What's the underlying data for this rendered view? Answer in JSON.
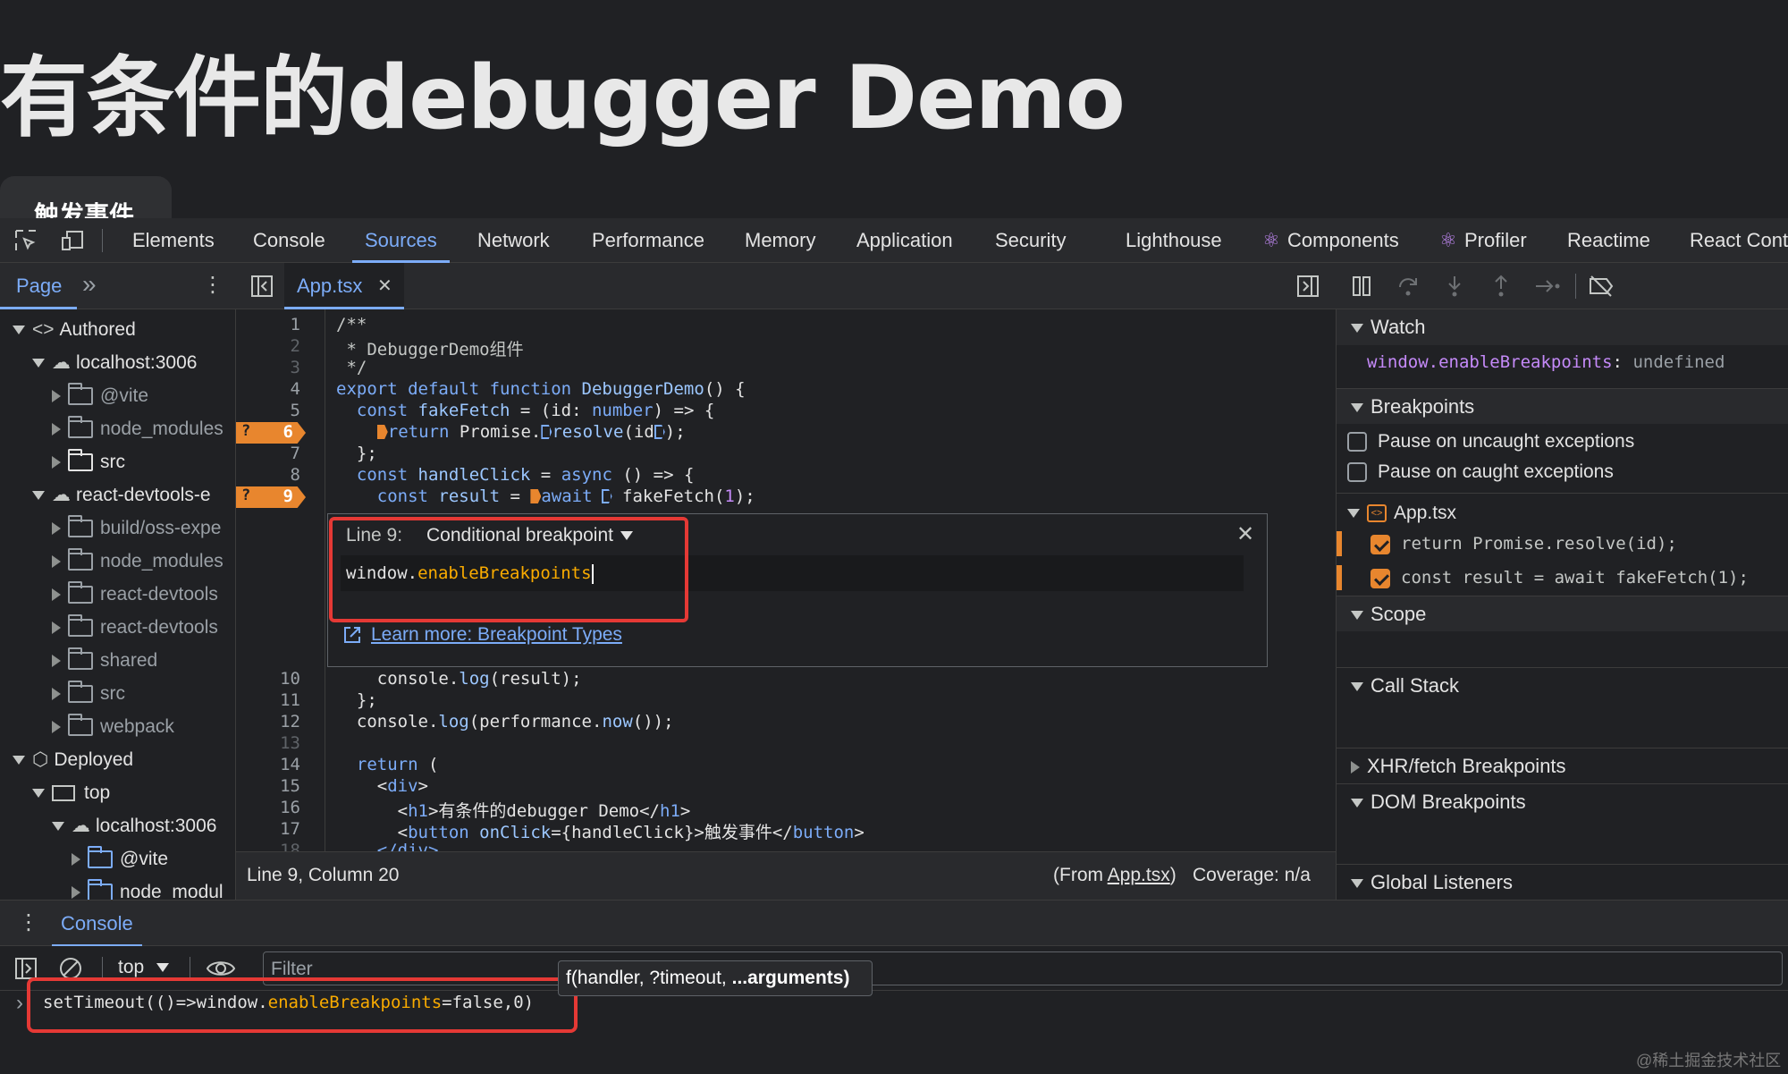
{
  "page": {
    "heading": "有条件的debugger Demo",
    "button_label": "触发事件"
  },
  "devtools_tabs": [
    "Elements",
    "Console",
    "Sources",
    "Network",
    "Performance",
    "Memory",
    "Application",
    "Security",
    "Lighthouse",
    "Components",
    "Profiler",
    "Reactime",
    "React Cont"
  ],
  "active_tab": "Sources",
  "navigator": {
    "tab_label": "Page",
    "more": "»",
    "rows": [
      "Authored",
      "localhost:3006",
      "@vite",
      "node_modules",
      "src",
      "react-devtools-e",
      "build/oss-expe",
      "node_modules",
      "react-devtools",
      "react-devtools",
      "shared",
      "src",
      "webpack",
      "Deployed",
      "top",
      "localhost:3006",
      "@vite",
      "node_modul"
    ]
  },
  "editor": {
    "file_tab": "App.tsx",
    "close": "✕",
    "line_numbers": [
      "1",
      "2",
      "3",
      "4",
      "5",
      "6",
      "7",
      "8",
      "9",
      "10",
      "11",
      "12",
      "13",
      "14",
      "15",
      "16",
      "17",
      "18"
    ],
    "breakpoint_q": "?",
    "lines_top": {
      "l1": "/**",
      "l2": " * DebuggerDemo组件",
      "l3": " */",
      "l4a": "export default function ",
      "l4b": "DebuggerDemo",
      "l4c": "() {",
      "l5a": "  const ",
      "l5b": "fakeFetch",
      "l5c": " = (id: ",
      "l5d": "number",
      "l5e": ") => {",
      "l6a": "    ",
      "l6b": "return",
      "l6c": " Promise.",
      "l6d": "resolve",
      "l6e": "(id",
      "l6f": ");",
      "l7": "  };",
      "l8a": "  const ",
      "l8b": "handleClick",
      "l8c": " = ",
      "l8d": "async",
      "l8e": " () => {",
      "l9a": "    const ",
      "l9b": "result",
      "l9c": " = ",
      "l9d": "await",
      "l9e": " fakeFetch(",
      "l9f": "1",
      "l9g": ");"
    },
    "lines_bottom": {
      "l10a": "    console.",
      "l10b": "log",
      "l10c": "(result);",
      "l11": "  };",
      "l12a": "  console.",
      "l12b": "log",
      "l12c": "(performance.",
      "l12d": "now",
      "l12e": "());",
      "l14a": "  ",
      "l14b": "return",
      "l14c": " (",
      "l15a": "    <",
      "l15b": "div",
      "l15c": ">",
      "l16a": "      <",
      "l16b": "h1",
      "l16c": ">有条件的debugger Demo</",
      "l16d": "h1",
      "l16e": ">",
      "l17a": "      <",
      "l17b": "button",
      "l17c": " onClick",
      "l17d": "={handleClick}>触发事件</",
      "l17e": "button",
      "l17f": ">",
      "l18": "    </div>"
    }
  },
  "bp_dialog": {
    "line_label": "Line 9:",
    "type": "Conditional breakpoint",
    "expr_a": "window.",
    "expr_b": "enableBreakpoints",
    "learn_more": "Learn more: Breakpoint Types",
    "close": "✕"
  },
  "status": {
    "position": "Line 9, Column 20",
    "from_prefix": "(From ",
    "from_file": "App.tsx",
    "from_suffix": ")",
    "coverage": "Coverage: n/a"
  },
  "right_panel": {
    "watch": "Watch",
    "watch_expr": "window.enableBreakpoints",
    "watch_colon": ":",
    "watch_value": "undefined",
    "breakpoints": "Breakpoints",
    "pause_uncaught": "Pause on uncaught exceptions",
    "pause_caught": "Pause on caught exceptions",
    "bp_file": "App.tsx",
    "bp1": "return Promise.resolve(id);",
    "bp2": "const result = await fakeFetch(1);",
    "scope": "Scope",
    "call_stack": "Call Stack",
    "xhr": "XHR/fetch Breakpoints",
    "dom": "DOM Breakpoints",
    "global": "Global Listeners"
  },
  "console": {
    "drawer_tab": "Console",
    "context": "top",
    "filter_placeholder": "Filter",
    "tooltip_a": "f(handler, ?timeout, ",
    "tooltip_b": "...arguments)",
    "prompt": "›",
    "input_a": "setTimeout(()=>window.",
    "input_b": "enableBreakpoints",
    "input_c": "=false,0)"
  },
  "watermark": "@稀土掘金技术社区",
  "colors": {
    "accent": "#7cacf8",
    "breakpoint": "#e8862e",
    "highlight_box": "#e53935",
    "background": "#202124"
  }
}
